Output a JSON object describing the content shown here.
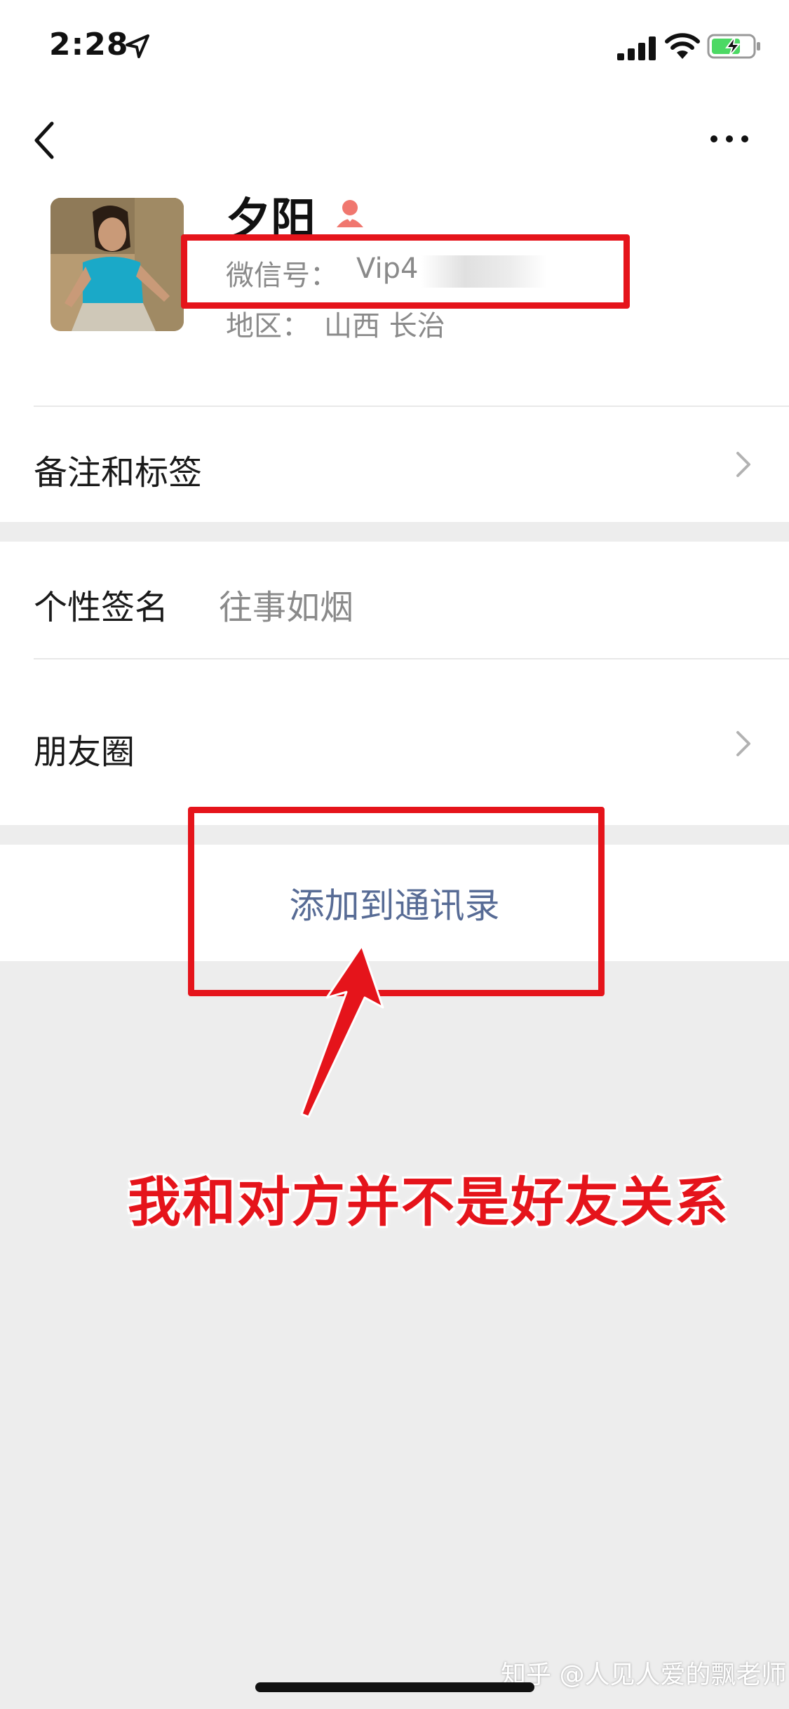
{
  "status_bar": {
    "time": "2:28"
  },
  "profile": {
    "nickname": "夕阳",
    "wechat_id_label": "微信号：",
    "wechat_id_value": "Vip4",
    "region_label": "地区：",
    "region_value": "山西 长治"
  },
  "rows": {
    "remarks_label": "备注和标签",
    "signature_label": "个性签名",
    "signature_value": "往事如烟",
    "moments_label": "朋友圈"
  },
  "actions": {
    "add_contact": "添加到通讯录"
  },
  "annotation": "我和对方并不是好友关系",
  "watermark": "知乎 @人见人爱的飘老师",
  "colors": {
    "highlight": "#e5141b",
    "link": "#576b95",
    "gender_icon": "#f0776f",
    "background": "#ededed"
  },
  "icons": [
    "location-arrow-icon",
    "signal-icon",
    "wifi-icon",
    "battery-charging-icon",
    "back-chevron-icon",
    "more-icon",
    "female-gender-icon",
    "chevron-right-icon",
    "red-arrow-icon"
  ]
}
